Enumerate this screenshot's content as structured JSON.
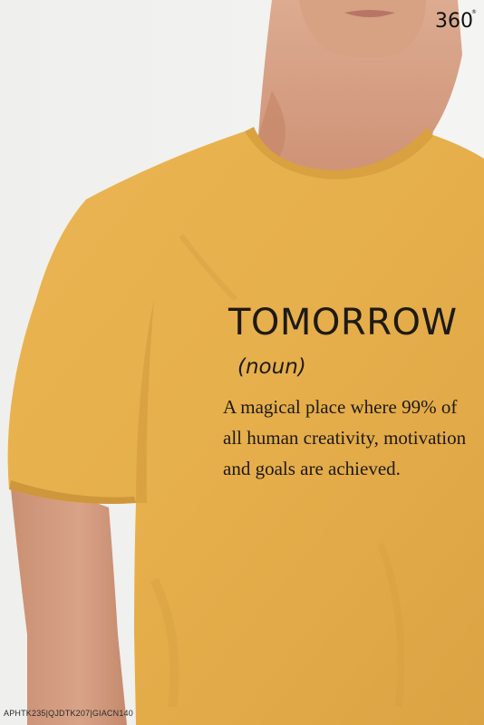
{
  "brand": {
    "logo_text": "360",
    "logo_mark": "®"
  },
  "tshirt_print": {
    "word": "TOMORROW",
    "part_of_speech": "(noun)",
    "definition_lines": [
      "A magical place where 99% of",
      "all human creativity, motivation",
      "and goals are achieved."
    ]
  },
  "product_code": "APHTK235|QJDTK207|GIACN140",
  "colors": {
    "shirt": "#e8b24e",
    "background": "#f2f2f0",
    "skin": "#d9a487",
    "print": "#1e1a14"
  }
}
